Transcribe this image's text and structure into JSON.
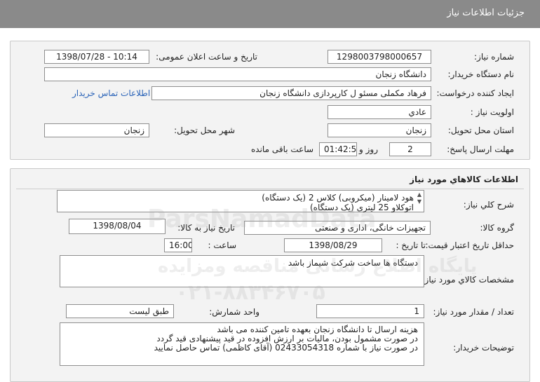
{
  "header": {
    "title": "جزئیات اطلاعات نیاز"
  },
  "details": {
    "need_number_label": "شماره نیاز:",
    "need_number": "1298003798000657",
    "announce_label": "تاریخ و ساعت اعلان عمومی:",
    "announce_value": "1398/07/28 - 10:14",
    "buyer_org_label": "نام دستگاه خریدار:",
    "buyer_org": "دانشگاه زنجان",
    "creator_label": "ایجاد کننده درخواست:",
    "creator": "فرهاد مکملی مسئو ل کارپردازی دانشگاه زنجان",
    "contact_link": "اطلاعات تماس خریدار",
    "priority_label": "اولویت نیاز :",
    "priority": "عادي",
    "province_label": "استان محل تحویل:",
    "province": "زنجان",
    "city_label": "شهر محل تحویل:",
    "city": "زنجان",
    "deadline_label": "مهلت ارسال پاسخ:",
    "deadline_days": "2",
    "days_word": "روز و",
    "deadline_time": "01:42:51",
    "remaining_label": "ساعت باقی مانده"
  },
  "goods": {
    "title": "اطلاعات کالاهاي مورد نياز",
    "general_desc_label": "شرح کلي نياز:",
    "general_desc_lines": [
      "هود لامینار (میکروبی) کلاس 2 (یک دستگاه)",
      "اتوکلاو 25 لیتری (یک دستگاه)"
    ],
    "goods_group_label": "گروه کالا:",
    "goods_group": "تجهیزات خانگی، اداری و صنعتی",
    "need_date_label": "تاریخ نیاز به کالا:",
    "need_date": "1398/08/04",
    "min_validity_label": "حداقل تاریخ اعتبار قیمت:",
    "until_date_label": "تا تاریخ :",
    "until_date": "1398/08/29",
    "time_label": "ساعت :",
    "time_value": "16:00",
    "specs_label": "مشخصات کالاي مورد نياز:",
    "specs": "دستگاه ها ساخت شرکت شیماز باشد",
    "qty_label": "تعداد / مقدار مورد نیاز:",
    "qty": "1",
    "unit_label": "واحد شمارش:",
    "unit": "طبق لیست",
    "buyer_notes_label": "توضیحات خریدار:",
    "buyer_notes_lines": [
      "هزینه ارسال تا دانشگاه زنجان بعهده تامین کننده می باشد",
      "در صورت مشمول بودن، مالیات بر ارزش افزوده در قید پیشنهادی قید گردد",
      "در صورت نیاز با شماره 02433054318 (آقای کاظمی) تماس حاصل نمایید"
    ]
  },
  "watermark": {
    "brand": "ParsNamadData",
    "line1": "پایگاه اطلاع رسانی مناقصه ومزایده",
    "phone": "۰۲۱-۸۸۳۴۶۷۰۵"
  }
}
